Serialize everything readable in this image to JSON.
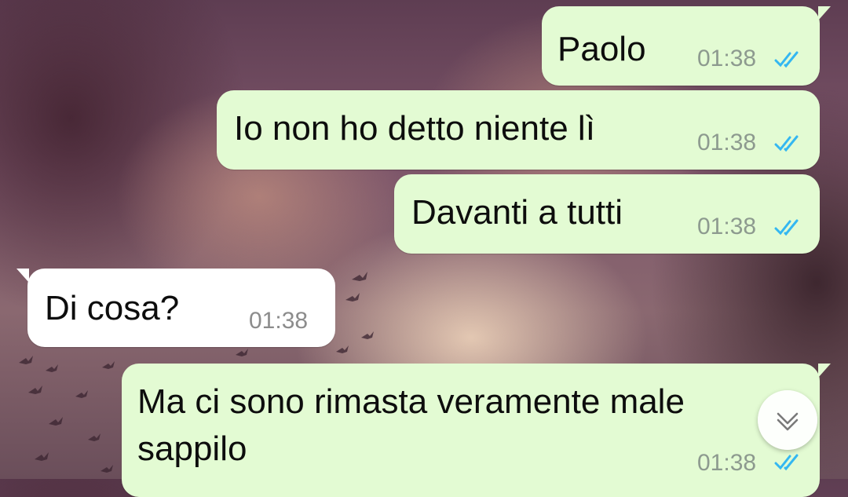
{
  "messages": [
    {
      "direction": "outgoing",
      "text": "Paolo",
      "time": "01:38",
      "status_icon": "double-check-read-icon"
    },
    {
      "direction": "outgoing",
      "text": "Io non ho detto niente lì",
      "time": "01:38",
      "status_icon": "double-check-read-icon"
    },
    {
      "direction": "outgoing",
      "text": "Davanti a tutti",
      "time": "01:38",
      "status_icon": "double-check-read-icon"
    },
    {
      "direction": "incoming",
      "text": "Di cosa?",
      "time": "01:38"
    },
    {
      "direction": "outgoing",
      "text_line1": "Ma ci sono rimasta veramente male",
      "text_line2": "sappilo",
      "time": "01:38",
      "status_icon": "double-check-read-icon"
    }
  ],
  "scroll_button": {
    "icon": "chevron-down-icon"
  },
  "colors": {
    "outgoing_bubble": "#e3fbd3",
    "incoming_bubble": "#ffffff",
    "read_ticks": "#34b7f1"
  }
}
